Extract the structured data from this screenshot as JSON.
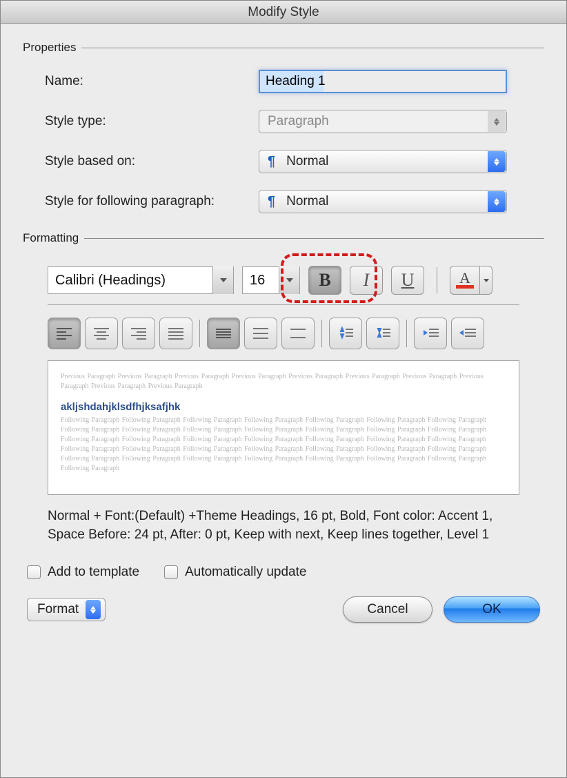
{
  "dialog": {
    "title": "Modify Style"
  },
  "properties": {
    "section_label": "Properties",
    "name_label": "Name:",
    "name_value": "Heading 1",
    "style_type_label": "Style type:",
    "style_type_value": "Paragraph",
    "based_on_label": "Style based on:",
    "based_on_value": "Normal",
    "following_label": "Style for following paragraph:",
    "following_value": "Normal"
  },
  "formatting": {
    "section_label": "Formatting",
    "font_name": "Calibri (Headings)",
    "font_size": "16",
    "bold_glyph": "B",
    "italic_glyph": "I",
    "underline_glyph": "U",
    "fontcolor_glyph": "A"
  },
  "preview": {
    "previous_line": "Previous Paragraph Previous Paragraph Previous Paragraph Previous Paragraph Previous Paragraph Previous Paragraph Previous Paragraph Previous Paragraph Previous Paragraph Previous Paragraph",
    "sample": "akljshdahjklsdfhjksafjhk",
    "following_line": "Following Paragraph Following Paragraph Following Paragraph Following Paragraph Following Paragraph Following Paragraph Following Paragraph Following Paragraph Following Paragraph Following Paragraph Following Paragraph Following Paragraph Following Paragraph Following Paragraph Following Paragraph Following Paragraph Following Paragraph Following Paragraph Following Paragraph Following Paragraph Following Paragraph Following Paragraph Following Paragraph Following Paragraph Following Paragraph Following Paragraph Following Paragraph Following Paragraph Following Paragraph Following Paragraph Following Paragraph Following Paragraph Following Paragraph Following Paragraph Following Paragraph Following Paragraph"
  },
  "description": "Normal + Font:(Default) +Theme Headings, 16 pt, Bold, Font color: Accent 1, Space Before:  24 pt, After:  0 pt, Keep with next, Keep lines together, Level 1",
  "checkboxes": {
    "add_to_template": "Add to template",
    "auto_update": "Automatically update"
  },
  "buttons": {
    "format": "Format",
    "cancel": "Cancel",
    "ok": "OK"
  },
  "pilcrow": "¶"
}
